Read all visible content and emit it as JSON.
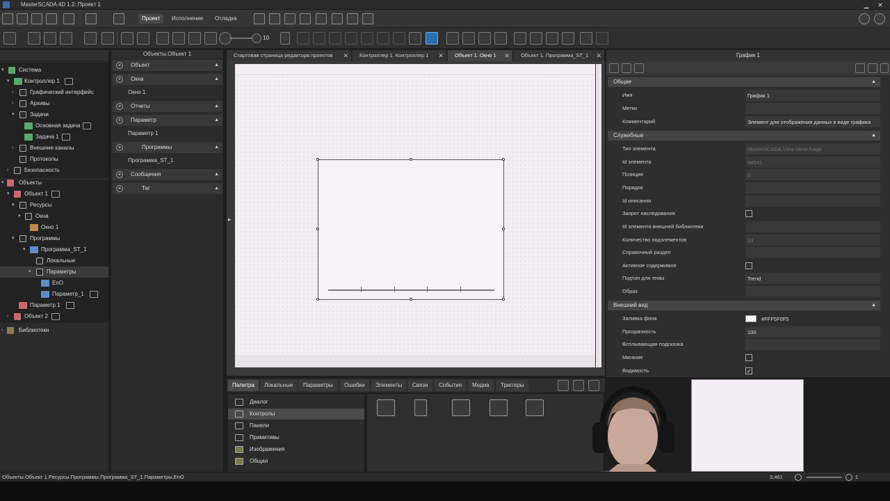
{
  "window": {
    "title": "MasterSCADA 4D 1.2: Проект 1"
  },
  "ribbon": {
    "tabs": [
      "Проект",
      "Исполнение",
      "Отладка"
    ],
    "active_tab": "Проект"
  },
  "toolbar": {
    "zoom_value": "10"
  },
  "tree": {
    "items": [
      {
        "label": "Система"
      },
      {
        "label": "Контроллер 1"
      },
      {
        "label": "Графический интерфейс"
      },
      {
        "label": "Архивы"
      },
      {
        "label": "Задачи"
      },
      {
        "label": "Основная задача"
      },
      {
        "label": "Задача 1"
      },
      {
        "label": "Внешние каналы"
      },
      {
        "label": "Протоколы"
      },
      {
        "label": "Безопасность"
      },
      {
        "label": "Объекты"
      },
      {
        "label": "Объект 1"
      },
      {
        "label": "Ресурсы"
      },
      {
        "label": "Окна"
      },
      {
        "label": "Окно 1"
      },
      {
        "label": "Программы"
      },
      {
        "label": "Программа_ST_1"
      },
      {
        "label": "Локальные"
      },
      {
        "label": "Параметры"
      },
      {
        "label": "EnO"
      },
      {
        "label": "Параметр_1"
      },
      {
        "label": "Параметр 1"
      },
      {
        "label": "Объект 2"
      },
      {
        "label": "Библиотеки"
      }
    ]
  },
  "objects_panel": {
    "title": "Объекты.Объект 1",
    "sections": [
      {
        "label": "Объект",
        "item": ""
      },
      {
        "label": "Окна",
        "item": "Окно 1"
      },
      {
        "label": "Отчеты",
        "item": ""
      },
      {
        "label": "Параметр",
        "item": "Параметр 1"
      },
      {
        "label": "Программы",
        "item": "Программа_ST_1"
      },
      {
        "label": "Сообщения",
        "item": ""
      },
      {
        "label": "Тег",
        "item": ""
      }
    ]
  },
  "doc_tabs": [
    {
      "label": "Стартовая страница редактора проектов"
    },
    {
      "label": "Контроллер 1. Контроллер 1"
    },
    {
      "label": "Объект 1. Окно 1"
    },
    {
      "label": "Объект 1. Программа_ST_1"
    }
  ],
  "palette": {
    "tabs": [
      "Палитра",
      "Локальные",
      "Параметры",
      "Ошибки",
      "Элементы",
      "Связи",
      "События",
      "Медиа",
      "Триггеры"
    ],
    "categories": [
      "Диалог",
      "Контролы",
      "Панели",
      "Примитивы",
      "Изображения",
      "Общая"
    ]
  },
  "properties": {
    "title": "График 1",
    "cat_general": "Общие",
    "cat_service": "Служебные",
    "cat_appearance": "Внешний вид",
    "rows": [
      {
        "key": "Имя",
        "value": "График 1"
      },
      {
        "key": "Метки",
        "value": ""
      },
      {
        "key": "Комментарий",
        "value": "Элемент для отображения данных в виде графика"
      },
      {
        "key": "Тип элемента",
        "value": "MasterSCADA.View.ViewUsage"
      },
      {
        "key": "Id элемента",
        "value": "58542"
      },
      {
        "key": "Позиция",
        "value": "0"
      },
      {
        "key": "Порядок",
        "value": ""
      },
      {
        "key": "Id описания",
        "value": ""
      },
      {
        "key": "Запрет наследования",
        "value": ""
      },
      {
        "key": "Id элемента внешней библиотеки",
        "value": ""
      },
      {
        "key": "Количество подэлементов",
        "value": "13"
      },
      {
        "key": "Справочный раздел",
        "value": ""
      },
      {
        "key": "Активное содержимое",
        "value": ""
      },
      {
        "key": "Подтип для темы",
        "value": "Trend"
      },
      {
        "key": "Образ",
        "value": ""
      },
      {
        "key": "Заливка фона",
        "value": "#FFF5F0F5"
      },
      {
        "key": "Прозрачность",
        "value": "100"
      },
      {
        "key": "Всплывающая подсказка",
        "value": ""
      },
      {
        "key": "Мигание",
        "value": ""
      },
      {
        "key": "Видимость",
        "value": ""
      }
    ]
  },
  "statusbar": {
    "path": "Объекты.Объект 1.Ресурсы.Программы.Программа_ST_1.Параметры.EnO",
    "zoom": "3,461",
    "zoom_level": "1"
  }
}
